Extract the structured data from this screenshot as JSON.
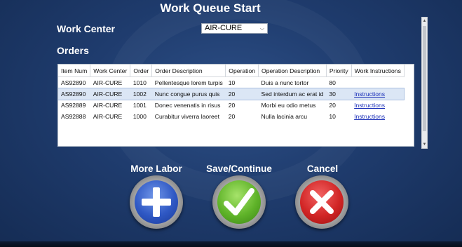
{
  "title": "Work Queue Start",
  "work_center": {
    "label": "Work Center",
    "selected": "AIR-CURE"
  },
  "orders": {
    "label": "Orders",
    "columns": [
      "Item Num",
      "Work Center",
      "Order",
      "Order Description",
      "Operation",
      "Operation Description",
      "Priority",
      "Work Instructions"
    ],
    "rows": [
      [
        "AS92890",
        "AIR-CURE",
        "1010",
        "Pellentesque lorem turpis",
        "10",
        "Duis a nunc tortor",
        "80",
        ""
      ],
      [
        "AS92890",
        "AIR-CURE",
        "1002",
        "Nunc congue purus quis",
        "20",
        "Sed interdum ac erat id",
        "30",
        "Instructions"
      ],
      [
        "AS92889",
        "AIR-CURE",
        "1001",
        "Donec venenatis in risus",
        "20",
        "Morbi eu odio metus",
        "20",
        "Instructions"
      ],
      [
        "AS92888",
        "AIR-CURE",
        "1000",
        "Curabitur viverra laoreet",
        "20",
        "Nulla lacinia arcu",
        "10",
        "Instructions"
      ]
    ]
  },
  "actions": {
    "more_labor": "More Labor",
    "save_continue": "Save/Continue",
    "cancel": "Cancel"
  },
  "colors": {
    "background": "#1f3c6e",
    "more_labor": "#2f58c4",
    "save_continue": "#5fb329",
    "cancel": "#d12525",
    "link": "#1a2fb8"
  },
  "icons": {
    "more_labor": "plus-icon",
    "save_continue": "checkmark-icon",
    "cancel": "x-icon",
    "select": "chevron-down-icon"
  }
}
